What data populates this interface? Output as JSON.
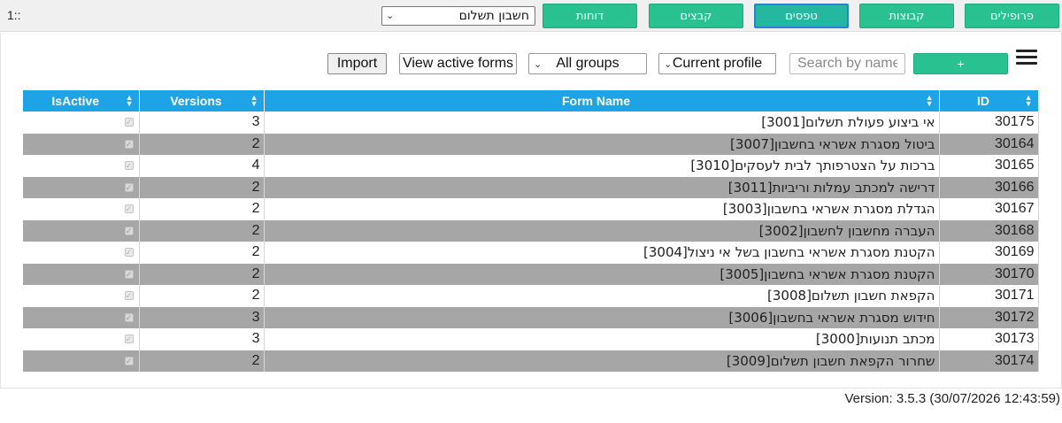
{
  "corner_label": "1::",
  "nav": {
    "form_selector": "חשבון תשלום",
    "buttons": [
      "דוחות",
      "קבצים",
      "טפסים",
      "קבוצות",
      "פרופילים"
    ],
    "active": "טפסים"
  },
  "toolbar": {
    "import_label": "Import",
    "view_active_label": "View active forms",
    "group_select": "All groups",
    "profile_select": "Current profile",
    "search_placeholder": "Search by name",
    "add_label": "+"
  },
  "table": {
    "columns": [
      "IsActive",
      "Versions",
      "Form Name",
      "ID"
    ],
    "rows": [
      {
        "id": "30175",
        "name": "אי ביצוע פעולת תשלום[3001]",
        "versions": "3",
        "active": true
      },
      {
        "id": "30164",
        "name": "ביטול מסגרת אשראי בחשבון[3007]",
        "versions": "2",
        "active": true
      },
      {
        "id": "30165",
        "name": "ברכות על הצטרפותך לבית לעסקים[3010]",
        "versions": "4",
        "active": true
      },
      {
        "id": "30166",
        "name": "דרישה למכתב עמלות וריביות[3011]",
        "versions": "2",
        "active": true
      },
      {
        "id": "30167",
        "name": "הגדלת מסגרת אשראי בחשבון[3003]",
        "versions": "2",
        "active": true
      },
      {
        "id": "30168",
        "name": "העברה מחשבון לחשבון[3002]",
        "versions": "2",
        "active": true
      },
      {
        "id": "30169",
        "name": "הקטנת מסגרת אשראי בחשבון בשל אי ניצול[3004]",
        "versions": "2",
        "active": true
      },
      {
        "id": "30170",
        "name": "הקטנת מסגרת אשראי בחשבון[3005]",
        "versions": "2",
        "active": true
      },
      {
        "id": "30171",
        "name": "הקפאת חשבון תשלום[3008]",
        "versions": "2",
        "active": true
      },
      {
        "id": "30172",
        "name": "חידוש מסגרת אשראי בחשבון[3006]",
        "versions": "3",
        "active": true
      },
      {
        "id": "30173",
        "name": "מכתב תנועות[3000]",
        "versions": "3",
        "active": true
      },
      {
        "id": "30174",
        "name": "שחרור הקפאת חשבון תשלום[3009]",
        "versions": "2",
        "active": true
      }
    ]
  },
  "footer": {
    "version": "Version: 3.5.3 (30/07/2026 12:43:59)"
  },
  "colors": {
    "accent_green": "#28c18f",
    "header_blue": "#1ea4e6",
    "alt_row": "#a6a6a6"
  }
}
